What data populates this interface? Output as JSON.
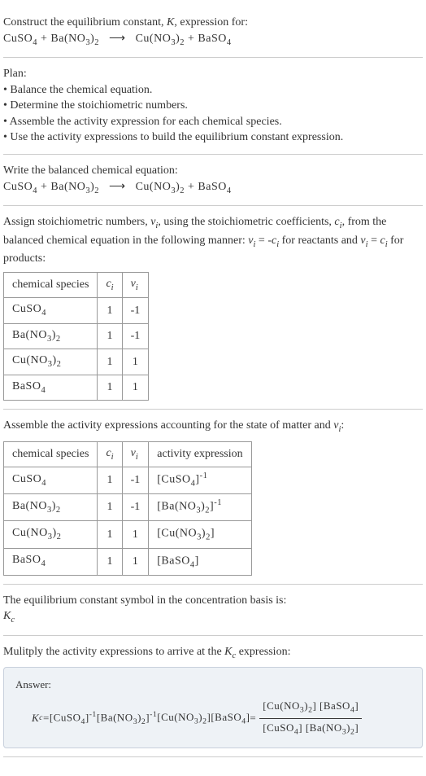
{
  "prompt": {
    "line1_a": "Construct the equilibrium constant, ",
    "line1_b": ", expression for:",
    "k": "K",
    "eq_lhs1": "CuSO",
    "eq_lhs1_sub": "4",
    "plus": " + ",
    "eq_lhs2": "Ba(NO",
    "eq_lhs2_sub1": "3",
    "eq_lhs2_close": ")",
    "eq_lhs2_sub2": "2",
    "arrow": "⟶",
    "eq_rhs1": "Cu(NO",
    "eq_rhs1_sub1": "3",
    "eq_rhs1_close": ")",
    "eq_rhs1_sub2": "2",
    "eq_rhs2": "BaSO",
    "eq_rhs2_sub": "4"
  },
  "plan": {
    "title": "Plan:",
    "b1": "• Balance the chemical equation.",
    "b2": "• Determine the stoichiometric numbers.",
    "b3": "• Assemble the activity expression for each chemical species.",
    "b4": "• Use the activity expressions to build the equilibrium constant expression."
  },
  "balanced": {
    "title": "Write the balanced chemical equation:"
  },
  "stoich": {
    "line1a": "Assign stoichiometric numbers, ",
    "nu": "ν",
    "sub_i": "i",
    "line1b": ", using the stoichiometric coefficients, ",
    "c": "c",
    "line1c": ", from the balanced chemical equation in the following manner: ",
    "rel1a": " = -",
    "rel1b": " for reactants and ",
    "rel2a": " = ",
    "rel2b": " for products:",
    "th1": "chemical species",
    "th2": "c",
    "th3": "ν",
    "rows": [
      {
        "sp_a": "CuSO",
        "sp_b": "4",
        "sp_c": "",
        "sp_d": "",
        "c": "1",
        "nu": "-1"
      },
      {
        "sp_a": "Ba(NO",
        "sp_b": "3",
        "sp_c": ")",
        "sp_d": "2",
        "c": "1",
        "nu": "-1"
      },
      {
        "sp_a": "Cu(NO",
        "sp_b": "3",
        "sp_c": ")",
        "sp_d": "2",
        "c": "1",
        "nu": "1"
      },
      {
        "sp_a": "BaSO",
        "sp_b": "4",
        "sp_c": "",
        "sp_d": "",
        "c": "1",
        "nu": "1"
      }
    ]
  },
  "activity": {
    "title_a": "Assemble the activity expressions accounting for the state of matter and ",
    "title_b": ":",
    "th4": "activity expression",
    "rows": [
      {
        "sp_a": "CuSO",
        "sp_b": "4",
        "sp_c": "",
        "sp_d": "",
        "c": "1",
        "nu": "-1",
        "ae_a": "[CuSO",
        "ae_b": "4",
        "ae_c": "]",
        "ae_sup": "-1",
        "ae_d": "",
        "ae_e": ""
      },
      {
        "sp_a": "Ba(NO",
        "sp_b": "3",
        "sp_c": ")",
        "sp_d": "2",
        "c": "1",
        "nu": "-1",
        "ae_a": "[Ba(NO",
        "ae_b": "3",
        "ae_c": ")",
        "ae_sup": "-1",
        "ae_d": "2",
        "ae_e": "]"
      },
      {
        "sp_a": "Cu(NO",
        "sp_b": "3",
        "sp_c": ")",
        "sp_d": "2",
        "c": "1",
        "nu": "1",
        "ae_a": "[Cu(NO",
        "ae_b": "3",
        "ae_c": ")",
        "ae_sup": "",
        "ae_d": "2",
        "ae_e": "]"
      },
      {
        "sp_a": "BaSO",
        "sp_b": "4",
        "sp_c": "",
        "sp_d": "",
        "c": "1",
        "nu": "1",
        "ae_a": "[BaSO",
        "ae_b": "4",
        "ae_c": "]",
        "ae_sup": "",
        "ae_d": "",
        "ae_e": ""
      }
    ]
  },
  "symbol": {
    "line1": "The equilibrium constant symbol in the concentration basis is:",
    "kc": "K",
    "kc_sub": "c"
  },
  "final": {
    "title_a": "Mulitply the activity expressions to arrive at the ",
    "title_b": " expression:",
    "answer": "Answer:",
    "eq": " = ",
    "t1": "[CuSO",
    "t1s": "4",
    "t1c": "]",
    "t2": " [Ba(NO",
    "t2s1": "3",
    "t2m": ")",
    "t2s2": "2",
    "t2c": "]",
    "t3": " [Cu(NO",
    "t3s1": "3",
    "t3m": ")",
    "t3s2": "2",
    "t3c": "]",
    "t4": " [BaSO",
    "t4s": "4",
    "t4c": "]",
    "neg1": "-1",
    "num_a": "[Cu(NO",
    "num_b": "3",
    "num_c": ")",
    "num_d": "2",
    "num_e": "] [BaSO",
    "num_f": "4",
    "num_g": "]",
    "den_a": "[CuSO",
    "den_b": "4",
    "den_c": "] [Ba(NO",
    "den_d": "3",
    "den_e": ")",
    "den_f": "2",
    "den_g": "]"
  }
}
